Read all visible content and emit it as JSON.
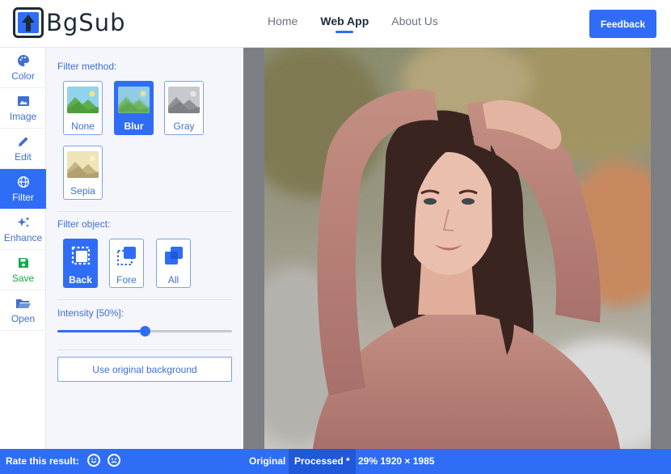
{
  "brand": {
    "name": "BgSub"
  },
  "nav": {
    "links": [
      {
        "label": "Home"
      },
      {
        "label": "Web App"
      },
      {
        "label": "About Us"
      }
    ],
    "feedback_label": "Feedback"
  },
  "toolbar": {
    "items": [
      {
        "label": "Color",
        "icon": "palette-icon"
      },
      {
        "label": "Image",
        "icon": "image-icon"
      },
      {
        "label": "Edit",
        "icon": "pencil-icon"
      },
      {
        "label": "Filter",
        "icon": "globe-icon"
      },
      {
        "label": "Enhance",
        "icon": "sparkles-icon"
      },
      {
        "label": "Save",
        "icon": "floppy-disk-icon"
      },
      {
        "label": "Open",
        "icon": "folder-open-icon"
      }
    ]
  },
  "filter_panel": {
    "method_title": "Filter method:",
    "methods": [
      {
        "label": "None"
      },
      {
        "label": "Blur"
      },
      {
        "label": "Gray"
      },
      {
        "label": "Sepia"
      }
    ],
    "object_title": "Filter object:",
    "objects": [
      {
        "label": "Back"
      },
      {
        "label": "Fore"
      },
      {
        "label": "All"
      }
    ],
    "intensity_label": "Intensity [50%]:",
    "intensity_value": 0.5,
    "original_bg_label": "Use original background"
  },
  "status_bar": {
    "rate_label": "Rate this result:",
    "original_label": "Original",
    "processed_label": "Processed *",
    "info": "29% 1920 × 1985"
  },
  "colors": {
    "accent": "#2f6df6",
    "save_green": "#18a64a"
  }
}
